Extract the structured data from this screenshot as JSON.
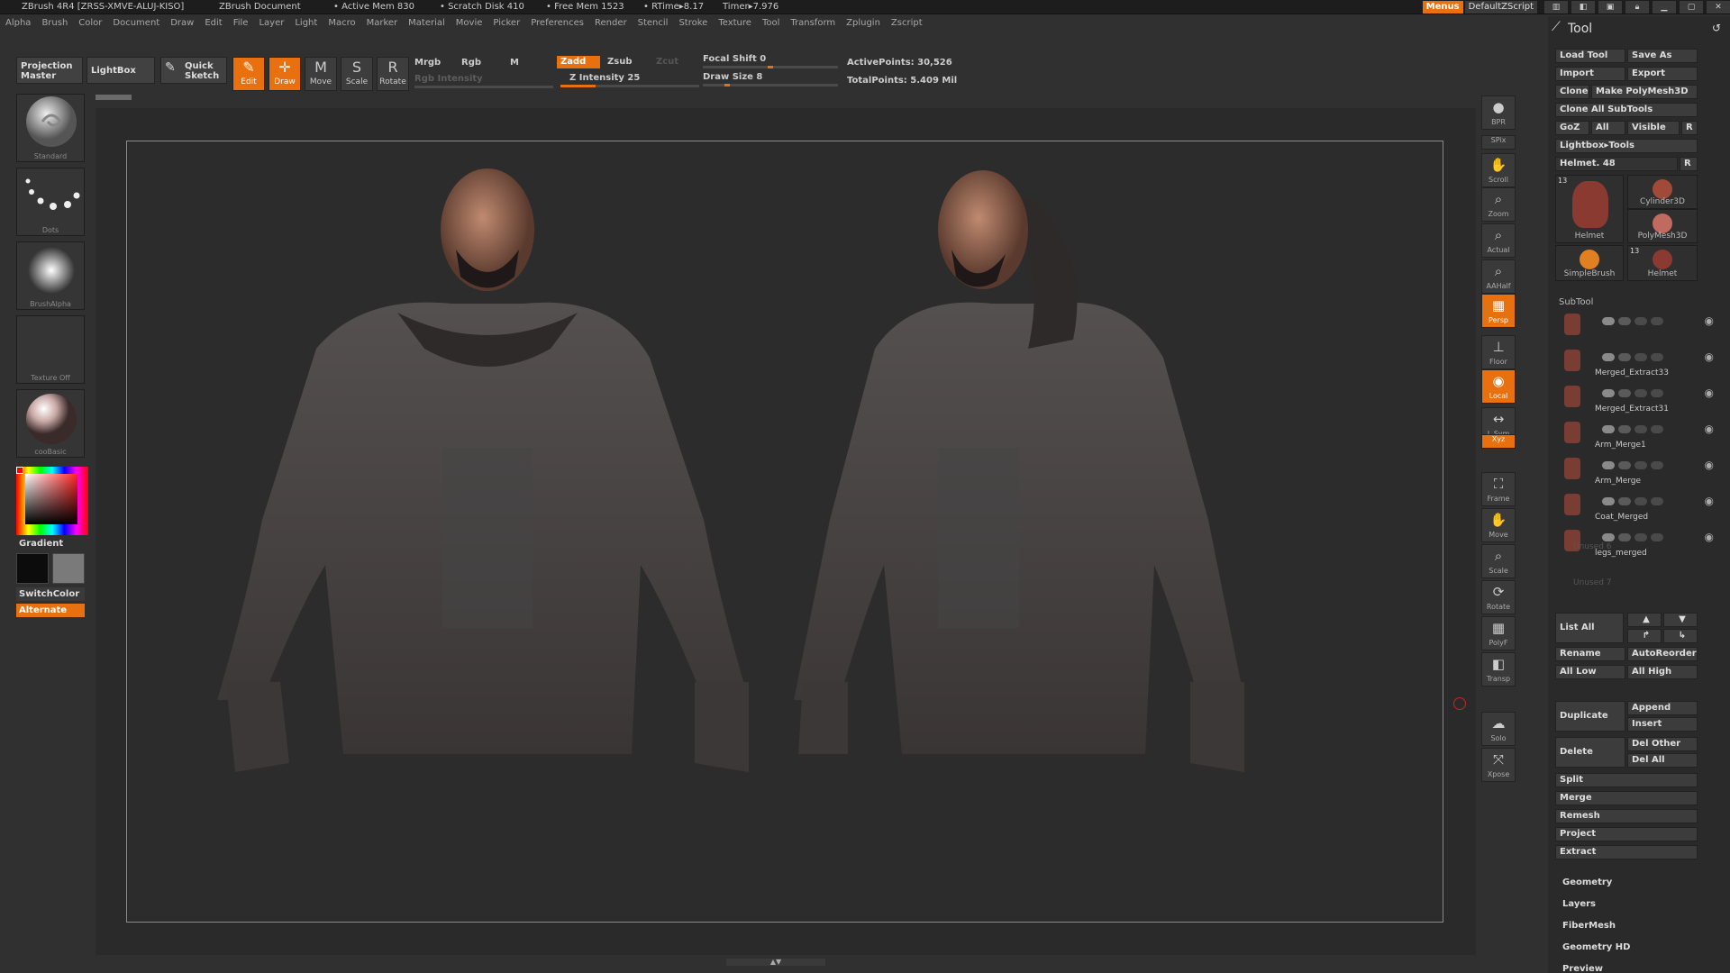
{
  "title_bar": {
    "app": "ZBrush 4R4 [ZRSS-XMVE-ALUJ-KISO]",
    "doc": "ZBrush Document",
    "active_mem": "• Active Mem 830",
    "scratch": "• Scratch Disk 410",
    "free_mem": "• Free Mem 1523",
    "rtime": "• RTime▸8.17",
    "timer": "Timer▸7.976",
    "menus_label": "Menus",
    "script_label": "DefaultZScript"
  },
  "menu_bar": [
    "Alpha",
    "Brush",
    "Color",
    "Document",
    "Draw",
    "Edit",
    "File",
    "Layer",
    "Light",
    "Macro",
    "Marker",
    "Material",
    "Movie",
    "Picker",
    "Preferences",
    "Render",
    "Stencil",
    "Stroke",
    "Texture",
    "Tool",
    "Transform",
    "Zplugin",
    "Zscript"
  ],
  "shelf": {
    "projection_master": "Projection Master",
    "lightbox": "LightBox",
    "quick_sketch": "Quick Sketch",
    "tools": [
      {
        "label": "Edit",
        "glyph": "✎",
        "on": true
      },
      {
        "label": "Draw",
        "glyph": "✛",
        "on": true
      },
      {
        "label": "Move",
        "glyph": "M",
        "on": false
      },
      {
        "label": "Scale",
        "glyph": "S",
        "on": false
      },
      {
        "label": "Rotate",
        "glyph": "R",
        "on": false
      }
    ],
    "mrgb": "Mrgb",
    "rgb": "Rgb",
    "m": "M",
    "rgb_intensity": "Rgb Intensity",
    "zadd": "Zadd",
    "zsub": "Zsub",
    "zcut": "Zcut",
    "z_intensity_label": "Z Intensity 25",
    "z_intensity_value": 25,
    "focal_shift_label": "Focal Shift 0",
    "focal_shift_value": 0,
    "draw_size_label": "Draw Size 8",
    "draw_size_value": 8,
    "active_points": "ActivePoints: 30,526",
    "total_points": "TotalPoints: 5.409 Mil"
  },
  "left_panel": {
    "brush": "Standard",
    "stroke": "Dots",
    "alpha": "BrushAlpha",
    "texture": "Texture Off",
    "material": "cooBasic",
    "gradient": "Gradient",
    "switch_color": "SwitchColor",
    "alternate": "Alternate"
  },
  "right_toolbar": [
    {
      "label": "BPR",
      "glyph": "●",
      "on": false
    },
    {
      "label": "SPix",
      "glyph": "",
      "on": false
    },
    {
      "label": "Scroll",
      "glyph": "✋",
      "on": false
    },
    {
      "label": "Zoom",
      "glyph": "⌕",
      "on": false
    },
    {
      "label": "Actual",
      "glyph": "⌕",
      "on": false
    },
    {
      "label": "AAHalf",
      "glyph": "⌕",
      "on": false
    },
    {
      "label": "Persp",
      "glyph": "▦",
      "on": true
    },
    {
      "label": "Floor",
      "glyph": "⊥",
      "on": false
    },
    {
      "label": "Local",
      "glyph": "◉",
      "on": true
    },
    {
      "label": "L.Sym",
      "glyph": "↔",
      "on": false
    },
    {
      "label": "Xyz",
      "glyph": "",
      "on": true
    },
    {
      "label": "Frame",
      "glyph": "⛶",
      "on": false
    },
    {
      "label": "Move",
      "glyph": "✋",
      "on": false
    },
    {
      "label": "Scale",
      "glyph": "⌕",
      "on": false
    },
    {
      "label": "Rotate",
      "glyph": "⟳",
      "on": false
    },
    {
      "label": "PolyF",
      "glyph": "▦",
      "on": false
    },
    {
      "label": "Transp",
      "glyph": "◧",
      "on": false
    },
    {
      "label": "Solo",
      "glyph": "☁",
      "on": false
    },
    {
      "label": "Xpose",
      "glyph": "⤧",
      "on": false
    }
  ],
  "tool_panel": {
    "title": "Tool",
    "load_tool": "Load Tool",
    "save_as": "Save As",
    "import": "Import",
    "export": "Export",
    "clone": "Clone",
    "make_polymesh": "Make PolyMesh3D",
    "clone_all": "Clone All SubTools",
    "goz": "GoZ",
    "all": "All",
    "visible": "Visible",
    "r": "R",
    "lightbox_tools": "Lightbox▸Tools",
    "current_tool": "Helmet. 48",
    "thumbs": [
      {
        "name": "Helmet",
        "badge": "13"
      },
      {
        "name": "Cylinder3D",
        "badge": ""
      },
      {
        "name": "PolyMesh3D",
        "badge": ""
      },
      {
        "name": "SimpleBrush",
        "badge": ""
      },
      {
        "name": "Helmet",
        "badge": "13"
      }
    ],
    "subtool_header": "SubTool",
    "subtools": [
      "",
      "Merged_Extract33",
      "Merged_Extract31",
      "Arm_Merge1",
      "Arm_Merge",
      "Coat_Merged",
      "legs_merged"
    ],
    "unused": [
      "Unused 6",
      "Unused 7"
    ],
    "list_all": "List  All",
    "rename": "Rename",
    "autoreorder": "AutoReorder",
    "all_low": "All Low",
    "all_high": "All High",
    "duplicate": "Duplicate",
    "append": "Append",
    "insert": "Insert",
    "delete": "Delete",
    "del_other": "Del Other",
    "del_all": "Del All",
    "split": "Split",
    "merge": "Merge",
    "remesh": "Remesh",
    "project": "Project",
    "extract": "Extract",
    "sections": [
      "Geometry",
      "Layers",
      "FiberMesh",
      "Geometry HD",
      "Preview"
    ]
  }
}
